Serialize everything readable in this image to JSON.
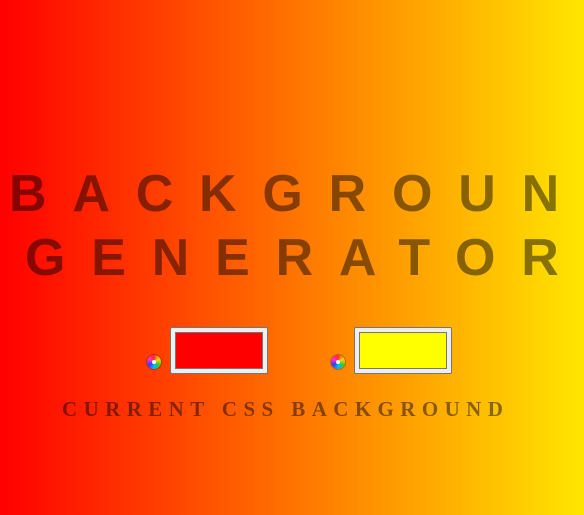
{
  "title": {
    "line1": "BACKGROUND",
    "line2": "GENERATOR"
  },
  "colors": {
    "gradient_start": "#ff0000",
    "gradient_end": "#ffe600",
    "color1": "#ff0000",
    "color2": "#ffff00"
  },
  "icons": {
    "picker1": "color-wheel-icon",
    "picker2": "color-wheel-icon"
  },
  "current_css_label": "CURRENT CSS BACKGROUND"
}
